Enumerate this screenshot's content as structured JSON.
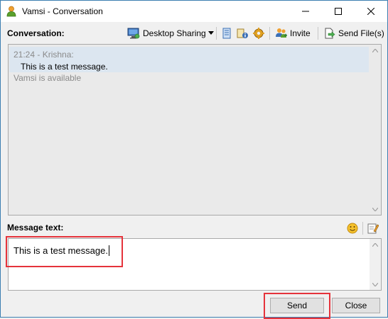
{
  "window": {
    "title": "Vamsi - Conversation"
  },
  "conversation": {
    "label": "Conversation:",
    "toolbar": {
      "desktop_sharing": "Desktop Sharing",
      "invite": "Invite",
      "send_files": "Send File(s)"
    },
    "messages": [
      {
        "header": "21:24 - Krishna:",
        "body": "This is a test message."
      }
    ],
    "status": "Vamsi is available"
  },
  "compose": {
    "label": "Message text:",
    "value": "This is a test message."
  },
  "buttons": {
    "send": "Send",
    "close": "Close"
  },
  "colors": {
    "highlight_box": "#e5333b",
    "message_highlight": "#dce6f0",
    "meta_text": "#8a8a8a"
  }
}
